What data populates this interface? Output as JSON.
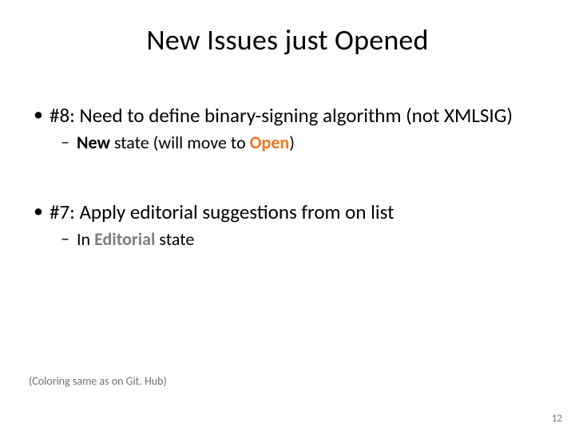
{
  "title": "New Issues just Opened",
  "issues": [
    {
      "headline": "#8: Need to define binary-signing algorithm (not XMLSIG)",
      "sub_prefix": "",
      "state_label": "New",
      "sub_mid": " state (will move to ",
      "move_label": "Open",
      "sub_suffix": ")"
    },
    {
      "headline": "#7: Apply editorial suggestions from on list",
      "sub_prefix": "In ",
      "state_label": "Editorial",
      "sub_mid": " state",
      "move_label": "",
      "sub_suffix": ""
    }
  ],
  "footnote": "(Coloring same as on Git. Hub)",
  "page_number": "12"
}
